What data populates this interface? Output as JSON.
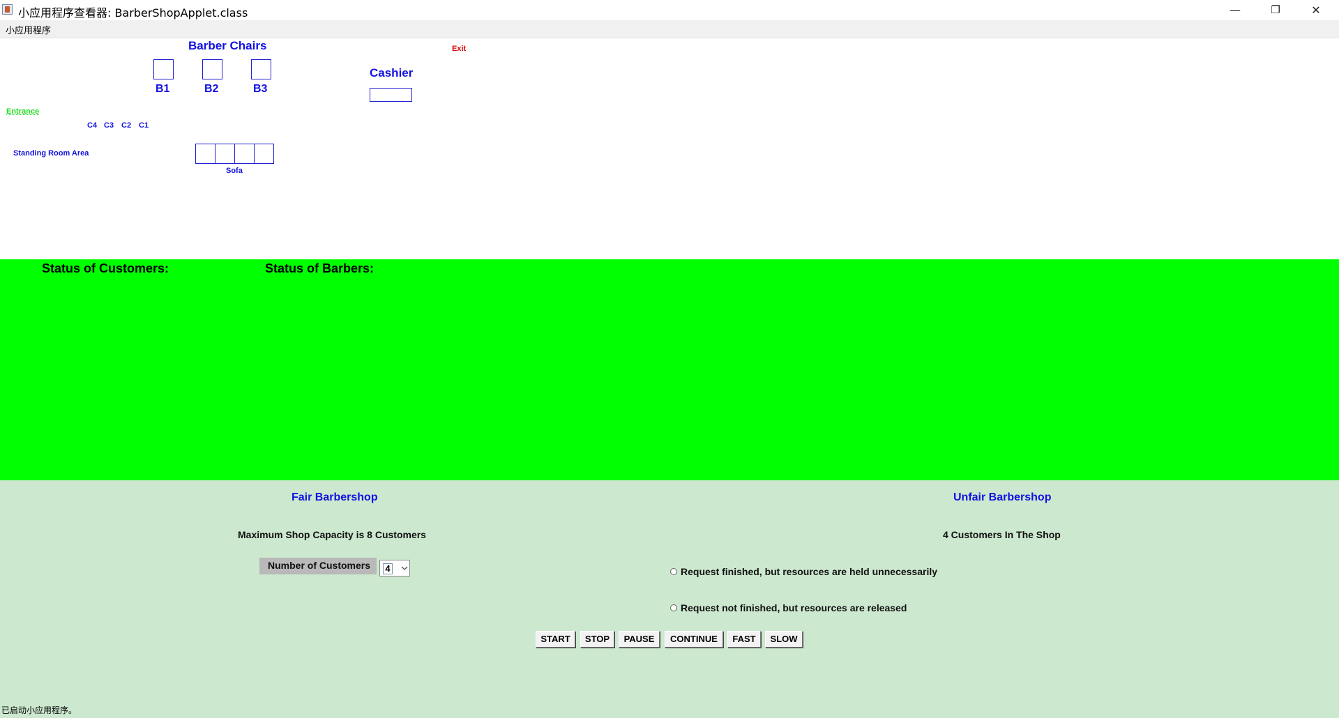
{
  "window": {
    "title": "小应用程序查看器: BarberShopApplet.class",
    "minimize_icon": "minimize-icon",
    "restore_icon": "restore-icon",
    "close_icon": "close-icon",
    "minimize_glyph": "—",
    "restore_glyph": "❐",
    "close_glyph": "✕"
  },
  "menu": {
    "applet_label": "小应用程序"
  },
  "shop": {
    "barber_chairs_title": "Barber Chairs",
    "chairs": [
      "B1",
      "B2",
      "B3"
    ],
    "cashier_label": "Cashier",
    "exit_label": "Exit",
    "entrance_label": "Entrance",
    "customers": [
      "C4",
      "C3",
      "C2",
      "C1"
    ],
    "standing_room_label": "Standing Room Area",
    "sofa_label": "Sofa"
  },
  "status": {
    "customers_title": "Status of Customers:",
    "barbers_title": "Status of Barbers:"
  },
  "controls": {
    "fair_title": "Fair Barbershop",
    "unfair_title": "Unfair Barbershop",
    "capacity_text": "Maximum Shop Capacity is 8 Customers",
    "in_shop_text": "4 Customers In The Shop",
    "num_customers_label": "Number of Customers",
    "num_customers_value": "4",
    "radio_1": "Request finished, but resources are held unnecessarily",
    "radio_2": "Request not finished, but resources are released",
    "buttons": {
      "start": "START",
      "stop": "STOP",
      "pause": "PAUSE",
      "continue": "CONTINUE",
      "fast": "FAST",
      "slow": "SLOW"
    }
  },
  "statusbar": {
    "text": "已启动小应用程序。"
  },
  "colors": {
    "status_panel_bg": "#00ff00",
    "control_panel_bg": "#cce8cf",
    "accent_blue": "#1212e0",
    "exit_red": "#e00000",
    "entrance_green": "#22dd22"
  }
}
